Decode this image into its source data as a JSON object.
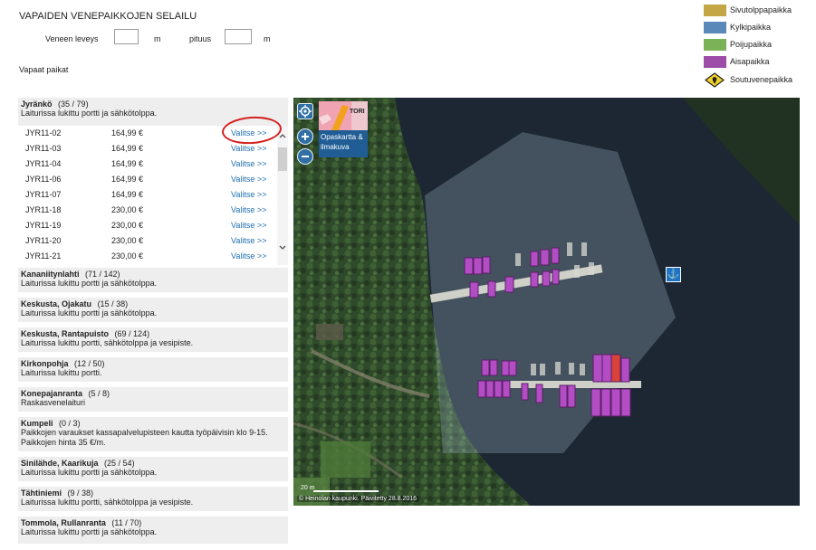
{
  "page": {
    "title": "VAPAIDEN VENEPAIKKOJEN SELAILU",
    "free_label": "Vapaat paikat"
  },
  "filters": {
    "width_label": "Veneen leveys",
    "width_value": "",
    "width_unit": "m",
    "length_label": "pituus",
    "length_value": "",
    "length_unit": "m"
  },
  "legend": [
    {
      "label": "Sivutolppapaikka",
      "color": "#c4a646"
    },
    {
      "label": "Kylkipaikka",
      "color": "#5a88b8"
    },
    {
      "label": "Poijupaikka",
      "color": "#7bb257"
    },
    {
      "label": "Aisapaikka",
      "color": "#9d4ca8"
    },
    {
      "label": "Soutuvenepaikka",
      "color": "#f2d22a",
      "icon": "location-pin-icon"
    }
  ],
  "expanded_harbour": {
    "name": "Jyränkö",
    "count": "(35 / 79)",
    "description": "Laiturissa lukittu portti ja sähkötolppa.",
    "select_label": "Valitse >>",
    "spots": [
      {
        "id": "JYR11-02",
        "price": "164,99 €"
      },
      {
        "id": "JYR11-03",
        "price": "164,99 €"
      },
      {
        "id": "JYR11-04",
        "price": "164,99 €"
      },
      {
        "id": "JYR11-06",
        "price": "164,99 €"
      },
      {
        "id": "JYR11-07",
        "price": "164,99 €"
      },
      {
        "id": "JYR11-18",
        "price": "230,00 €"
      },
      {
        "id": "JYR11-19",
        "price": "230,00 €"
      },
      {
        "id": "JYR11-20",
        "price": "230,00 €"
      },
      {
        "id": "JYR11-21",
        "price": "230,00 €"
      }
    ]
  },
  "harbours": [
    {
      "name": "Kananiitynlahti",
      "count": "(71 / 142)",
      "description": "Laiturissa lukittu portti ja sähkötolppa."
    },
    {
      "name": "Keskusta, Ojakatu",
      "count": "(15 / 38)",
      "description": "Laiturissa lukittu portti ja sähkötolppa."
    },
    {
      "name": "Keskusta, Rantapuisto",
      "count": "(69 / 124)",
      "description": "Laiturissa lukittu portti, sähkötolppa ja vesipiste."
    },
    {
      "name": "Kirkonpohja",
      "count": "(12 / 50)",
      "description": "Laiturissa lukittu portti."
    },
    {
      "name": "Konepajanranta",
      "count": "(5 / 8)",
      "description": "Raskasvenelaituri"
    },
    {
      "name": "Kumpeli",
      "count": "(0 / 3)",
      "description": "Paikkojen varaukset kassapalvelupisteen kautta työpäivisin klo 9-15. Paikkojen hinta 35 €/m."
    },
    {
      "name": "Sinilähde, Kaarikuja",
      "count": "(25 / 54)",
      "description": "Laiturissa lukittu portti ja sähkötolppa."
    },
    {
      "name": "Tähtiniemi",
      "count": "(9 / 38)",
      "description": "Laiturissa lukittu portti, sähkötolppa ja vesipiste."
    },
    {
      "name": "Tommola, Rullanranta",
      "count": "(11 / 70)",
      "description": "Laiturissa lukittu portti ja sähkötolppa."
    }
  ],
  "map": {
    "layer_label": "Opaskartta & ilmakuva",
    "layer_thumb_text": "TORI",
    "scale": "20 m",
    "copyright": "© Heinolan kaupunki. Päivitetty 28.8.2016",
    "spot_highlight_color": "#d9423b"
  }
}
